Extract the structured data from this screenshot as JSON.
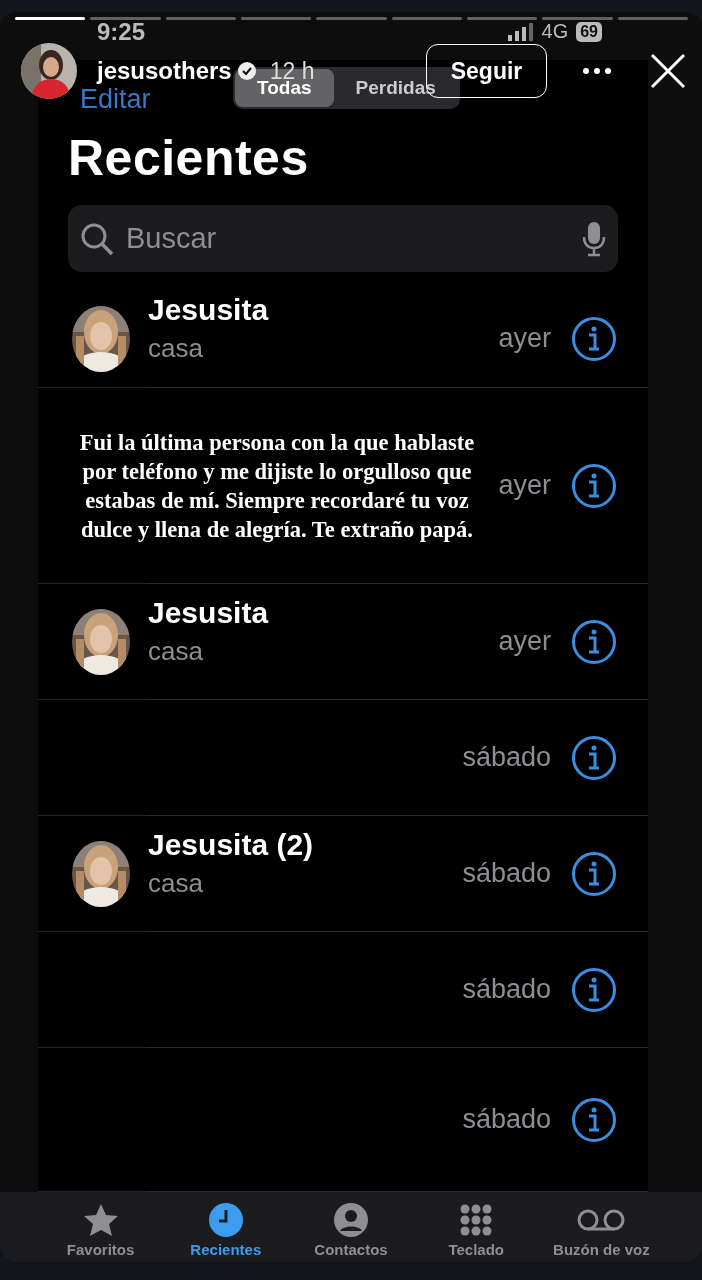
{
  "story_progress": [
    {
      "level": 1
    },
    {
      "level": 0
    },
    {
      "level": 0
    },
    {
      "level": 0
    },
    {
      "level": 0
    },
    {
      "level": 0
    },
    {
      "level": 0
    },
    {
      "level": 0
    },
    {
      "level": 0
    }
  ],
  "story_header": {
    "username": "jesusothers",
    "verified": true,
    "time": "12 h",
    "follow_button": "Seguir"
  },
  "status_bar": {
    "time": "9:25",
    "network": "4G",
    "battery": "69"
  },
  "nav": {
    "edit": "Editar",
    "segments": [
      {
        "label": "Todas",
        "selected": true
      },
      {
        "label": "Perdidas",
        "selected": false
      }
    ]
  },
  "title": "Recientes",
  "search": {
    "placeholder": "Buscar"
  },
  "calls": [
    {
      "kind": "contact",
      "name": "Jesusita",
      "label": "casa",
      "date": "ayer"
    },
    {
      "kind": "caption",
      "text": "Fui la última persona con la que hablaste por teléfono y me dijiste lo orgulloso que estabas de mí. Siempre recordaré tu voz dulce y llena de alegría. Te extraño papá.",
      "date": "ayer"
    },
    {
      "kind": "contact",
      "name": "Jesusita",
      "label": "casa",
      "date": "ayer"
    },
    {
      "kind": "blank",
      "date": "sábado"
    },
    {
      "kind": "contact",
      "name": "Jesusita (2)",
      "label": "casa",
      "date": "sábado"
    },
    {
      "kind": "blank",
      "date": "sábado"
    },
    {
      "kind": "blank",
      "date": "sábado"
    }
  ],
  "tabs": [
    {
      "kind": "star",
      "label": "Favoritos",
      "selected": false
    },
    {
      "kind": "clock",
      "label": "Recientes",
      "selected": true
    },
    {
      "kind": "person",
      "label": "Contactos",
      "selected": false
    },
    {
      "kind": "keypad",
      "label": "Teclado",
      "selected": false
    },
    {
      "kind": "voicemail",
      "label": "Buzón de voz",
      "selected": false
    }
  ]
}
